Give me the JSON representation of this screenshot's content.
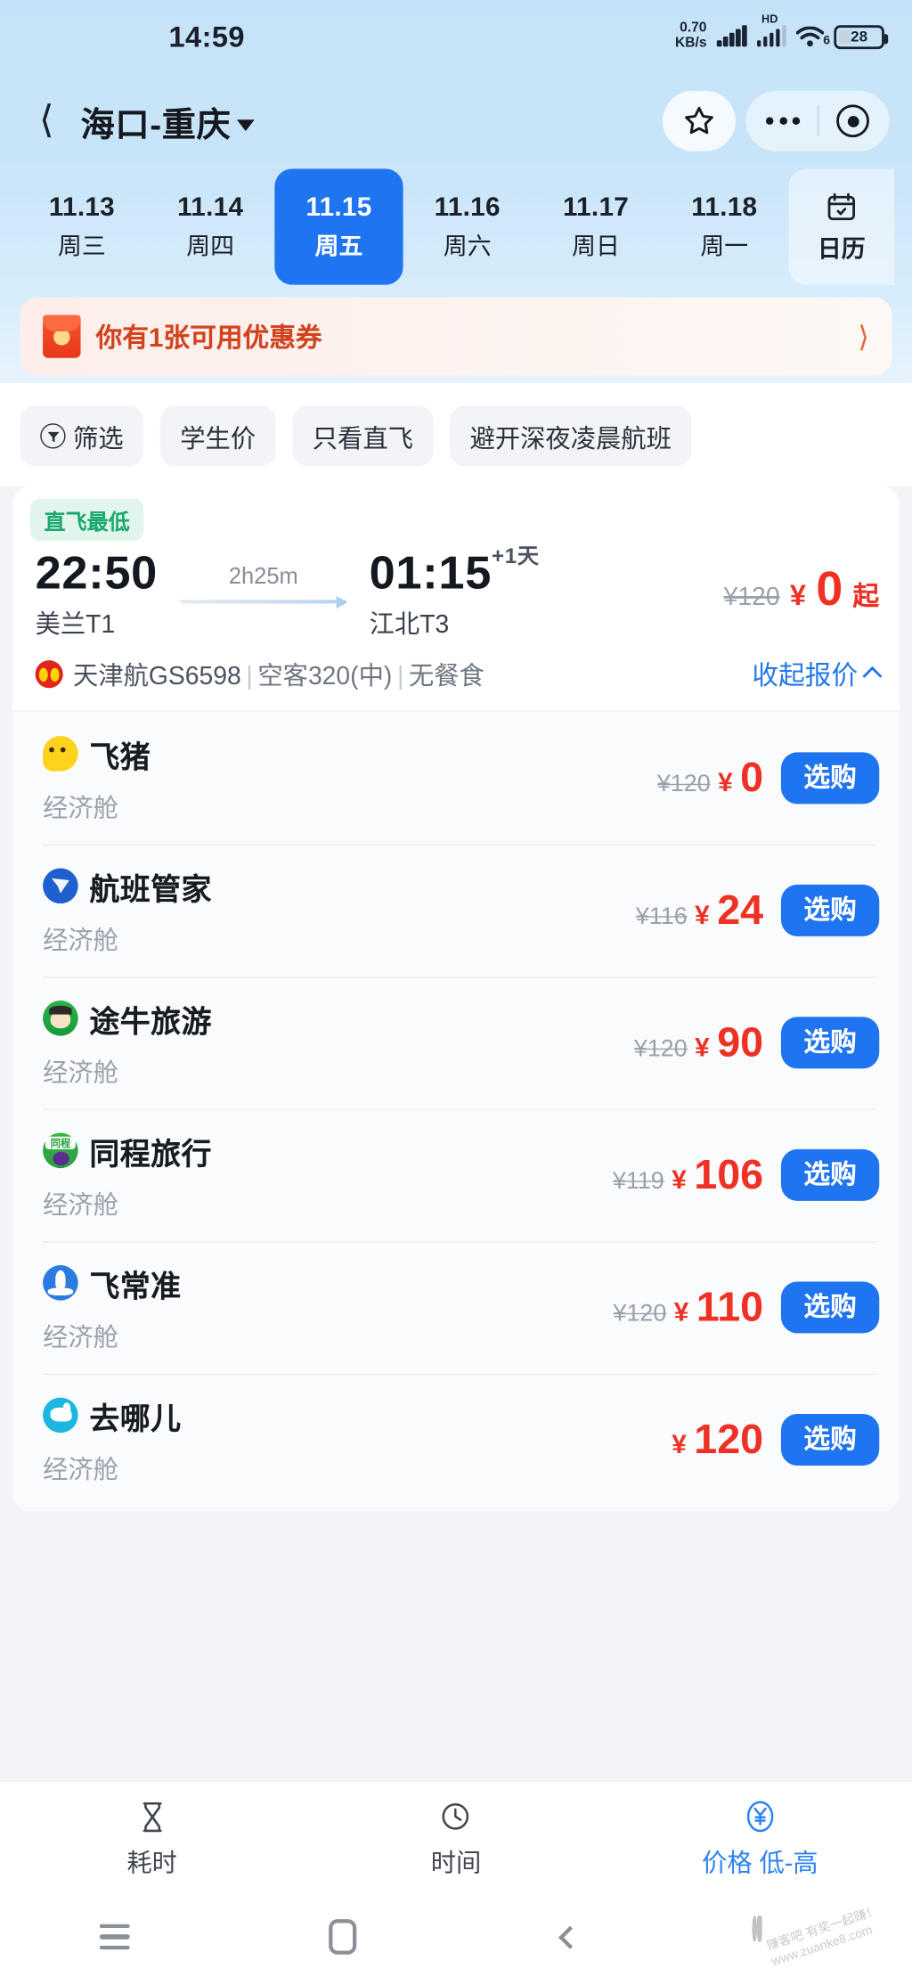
{
  "statusbar": {
    "time": "14:59",
    "net_speed": "0.70",
    "net_unit": "KB/s",
    "hd_label": "HD",
    "wifi_gen": "6",
    "battery": "28"
  },
  "header": {
    "back_icon": "chevron-left-icon",
    "route": "海口-重庆",
    "dropdown_icon": "caret-down-icon",
    "star_icon": "star-icon",
    "more_icon": "more-dots-icon",
    "target_icon": "target-icon"
  },
  "dates": [
    {
      "date": "11.13",
      "weekday": "周三",
      "active": false
    },
    {
      "date": "11.14",
      "weekday": "周四",
      "active": false
    },
    {
      "date": "11.15",
      "weekday": "周五",
      "active": true
    },
    {
      "date": "11.16",
      "weekday": "周六",
      "active": false
    },
    {
      "date": "11.17",
      "weekday": "周日",
      "active": false
    },
    {
      "date": "11.18",
      "weekday": "周一",
      "active": false
    }
  ],
  "calendar_button": {
    "label": "日历",
    "icon": "calendar-icon"
  },
  "coupon": {
    "icon": "red-packet-icon",
    "text": "你有1张可用优惠券",
    "arrow_icon": "chevron-right-icon"
  },
  "filters": [
    {
      "label": "筛选",
      "icon": "funnel-icon"
    },
    {
      "label": "学生价",
      "icon": null
    },
    {
      "label": "只看直飞",
      "icon": null
    },
    {
      "label": "避开深夜凌晨航班",
      "icon": null
    }
  ],
  "flight": {
    "badge": "直飞最低",
    "depart_time": "22:50",
    "depart_airport": "美兰T1",
    "duration": "2h25m",
    "arrive_time": "01:15",
    "arrive_day_offset": "+1天",
    "arrive_airport": "江北T3",
    "old_price": "¥120",
    "currency": "¥",
    "price": "0",
    "price_suffix": "起",
    "airline_logo": "hainan-airlines-icon",
    "airline": "天津航GS6598",
    "aircraft": "空客320(中)",
    "meal": "无餐食",
    "collapse_label": "收起报价",
    "collapse_icon": "chevron-up-icon"
  },
  "vendors": [
    {
      "logo": "fliggy-icon",
      "logo_class": "lg-fliggy",
      "name": "飞猪",
      "cabin": "经济舱",
      "old_price": "¥120",
      "currency": "¥",
      "price": "0",
      "button": "选购"
    },
    {
      "logo": "flight-manager-icon",
      "logo_class": "lg-hbgj",
      "name": "航班管家",
      "cabin": "经济舱",
      "old_price": "¥116",
      "currency": "¥",
      "price": "24",
      "button": "选购"
    },
    {
      "logo": "tuniu-icon",
      "logo_class": "lg-tuniu",
      "name": "途牛旅游",
      "cabin": "经济舱",
      "old_price": "¥120",
      "currency": "¥",
      "price": "90",
      "button": "选购"
    },
    {
      "logo": "tongcheng-icon",
      "logo_class": "lg-tongcheng",
      "name": "同程旅行",
      "cabin": "经济舱",
      "old_price": "¥119",
      "currency": "¥",
      "price": "106",
      "button": "选购"
    },
    {
      "logo": "variflight-icon",
      "logo_class": "lg-feichangzhun",
      "name": "飞常准",
      "cabin": "经济舱",
      "old_price": "¥120",
      "currency": "¥",
      "price": "110",
      "button": "选购"
    },
    {
      "logo": "qunar-icon",
      "logo_class": "lg-qunar",
      "name": "去哪儿",
      "cabin": "经济舱",
      "old_price": "",
      "currency": "¥",
      "price": "120",
      "button": "选购"
    }
  ],
  "sortbar": [
    {
      "label": "耗时",
      "icon": "hourglass-icon",
      "active": false
    },
    {
      "label": "时间",
      "icon": "clock-icon",
      "active": false
    },
    {
      "label": "价格 低-高",
      "icon": "yuan-circle-icon",
      "active": true
    }
  ],
  "navbar": {
    "menu_icon": "menu-icon",
    "home_icon": "home-square-icon",
    "back_icon": "back-chevron-icon",
    "watermark_line1": "赚客吧 有奖一起赚！",
    "watermark_line2": "www.zuanke8.com"
  },
  "colors": {
    "accent_blue": "#1f74f0",
    "price_red": "#ee3124",
    "badge_green": "#1aaa6e",
    "coupon_red": "#d0431d",
    "top_bg": "#c8e4f8"
  }
}
